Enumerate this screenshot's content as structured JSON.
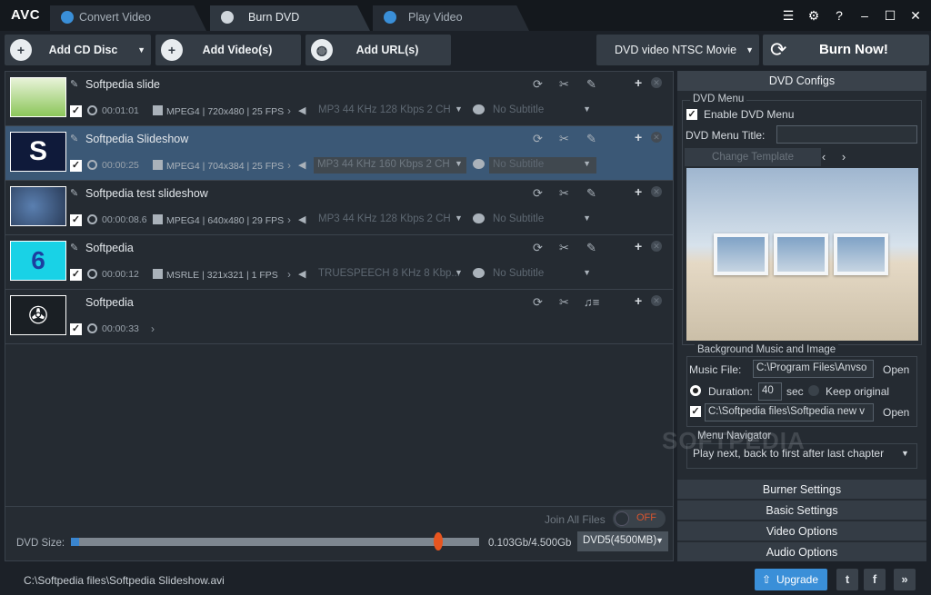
{
  "app": {
    "logo": "AVC"
  },
  "tabs": [
    {
      "label": "Convert Video",
      "active": false
    },
    {
      "label": "Burn DVD",
      "active": true
    },
    {
      "label": "Play Video",
      "active": false
    }
  ],
  "window_icons": [
    "menu-icon",
    "gear-icon",
    "help-icon",
    "minimize-icon",
    "maximize-icon",
    "close-icon"
  ],
  "toolbar": {
    "add_cd": "Add CD Disc",
    "add_video": "Add Video(s)",
    "add_url": "Add URL(s)",
    "preset": "DVD video NTSC Movie",
    "burn": "Burn Now!"
  },
  "files": [
    {
      "name": "Softpedia slide",
      "duration": "00:01:01",
      "video": "MPEG4 | 720x480 | 25 FPS",
      "audio": "MP3 44 KHz 128 Kbps 2 CH",
      "subtitle": "No Subtitle",
      "selected": false
    },
    {
      "name": "Softpedia Slideshow",
      "duration": "00:00:25",
      "video": "MPEG4 | 704x384 | 25 FPS",
      "audio": "MP3 44 KHz 160 Kbps 2 CH",
      "subtitle": "No Subtitle",
      "selected": true
    },
    {
      "name": "Softpedia test slideshow",
      "duration": "00:00:08.6",
      "video": "MPEG4 | 640x480 | 29 FPS",
      "audio": "MP3 44 KHz 128 Kbps 2 CH",
      "subtitle": "No Subtitle",
      "selected": false
    },
    {
      "name": "Softpedia",
      "duration": "00:00:12",
      "video": "MSRLE | 321x321 | 1 FPS",
      "audio": "TRUESPEECH 8 KHz 8 Kbp...",
      "subtitle": "No Subtitle",
      "selected": false
    },
    {
      "name": "Softpedia",
      "duration": "00:00:33",
      "video": "",
      "audio": "",
      "subtitle": "",
      "selected": false
    }
  ],
  "list_bottom": {
    "join_label": "Join All Files",
    "join_state": "OFF",
    "dvd_size_label": "DVD Size:",
    "size_text": "0.103Gb/4.500Gb",
    "dvd_type": "DVD5(4500MB)",
    "used_fraction": 0.02
  },
  "dvd_configs": {
    "header": "DVD Configs",
    "menu_group": "DVD Menu",
    "enable_menu": "Enable DVD Menu",
    "menu_title_label": "DVD Menu Title:",
    "menu_title_value": "",
    "change_template": "Change Template",
    "bg_group": "Background Music and Image",
    "music_label": "Music File:",
    "music_value": "C:\\Program Files\\Anvso",
    "open": "Open",
    "duration_label": "Duration:",
    "duration_value": "40",
    "sec": "sec",
    "keep_original": "Keep original",
    "image_value": "C:\\Softpedia files\\Softpedia new v",
    "navigator_group": "Menu Navigator",
    "navigator_value": "Play next, back to first after last chapter",
    "sections": [
      "Burner Settings",
      "Basic Settings",
      "Video Options",
      "Audio Options"
    ]
  },
  "status": {
    "path": "C:\\Softpedia files\\Softpedia Slideshow.avi",
    "upgrade": "Upgrade",
    "twitter": "t",
    "facebook": "f",
    "more": "»"
  },
  "watermark": "SOFTPEDIA"
}
